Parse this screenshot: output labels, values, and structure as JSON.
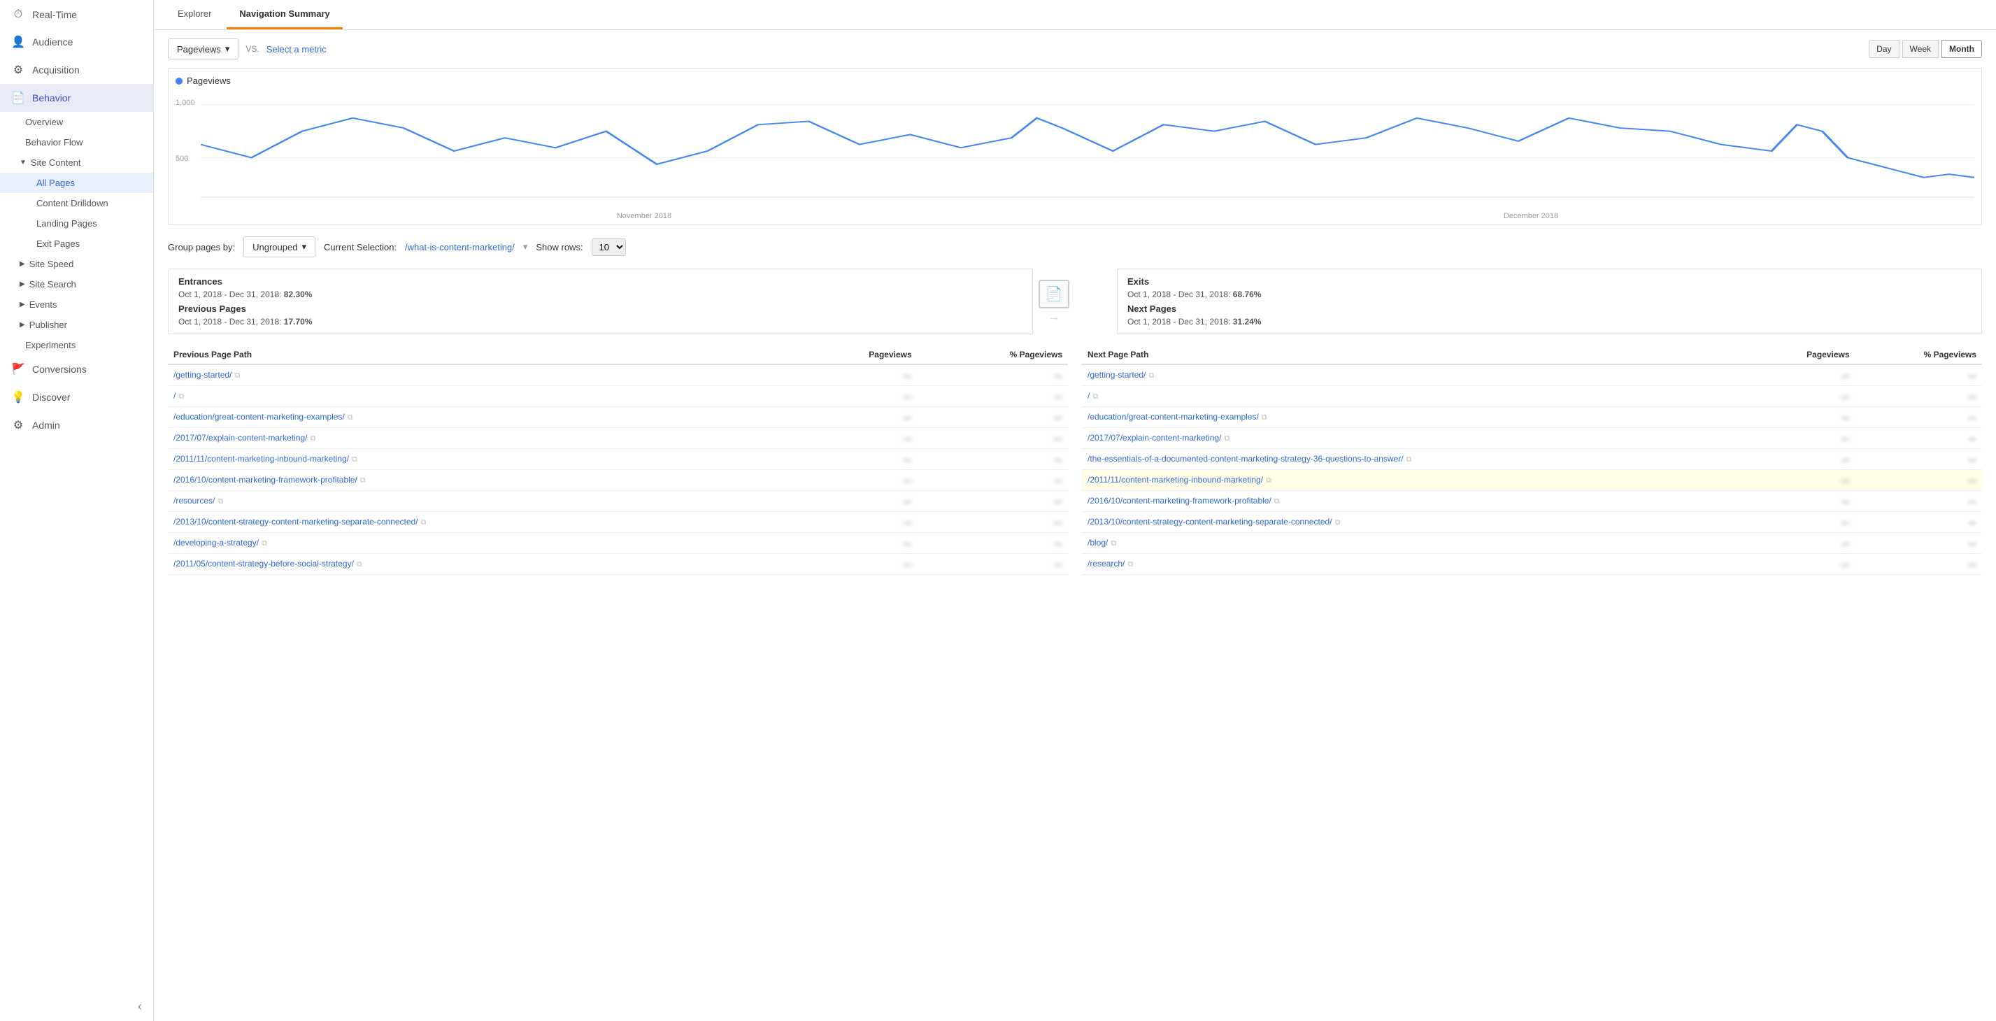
{
  "sidebar": {
    "items": [
      {
        "id": "realtime",
        "label": "Real-Time",
        "icon": "⏱"
      },
      {
        "id": "audience",
        "label": "Audience",
        "icon": "👤"
      },
      {
        "id": "acquisition",
        "label": "Acquisition",
        "icon": "⚙"
      },
      {
        "id": "behavior",
        "label": "Behavior",
        "icon": "📄",
        "active": true
      },
      {
        "id": "conversions",
        "label": "Conversions",
        "icon": "🚩"
      },
      {
        "id": "discover",
        "label": "Discover",
        "icon": "💡"
      },
      {
        "id": "admin",
        "label": "Admin",
        "icon": "⚙"
      }
    ],
    "sub_items": {
      "behavior": [
        {
          "id": "overview",
          "label": "Overview"
        },
        {
          "id": "behavior-flow",
          "label": "Behavior Flow"
        },
        {
          "id": "site-content",
          "label": "Site Content",
          "expandable": true,
          "expanded": true
        },
        {
          "id": "all-pages",
          "label": "All Pages",
          "active": true,
          "indent": true
        },
        {
          "id": "content-drilldown",
          "label": "Content Drilldown",
          "indent": true
        },
        {
          "id": "landing-pages",
          "label": "Landing Pages",
          "indent": true
        },
        {
          "id": "exit-pages",
          "label": "Exit Pages",
          "indent": true
        },
        {
          "id": "site-speed",
          "label": "Site Speed",
          "expandable": true
        },
        {
          "id": "site-search",
          "label": "Site Search",
          "expandable": true
        },
        {
          "id": "events",
          "label": "Events",
          "expandable": true
        },
        {
          "id": "publisher",
          "label": "Publisher",
          "expandable": true
        },
        {
          "id": "experiments",
          "label": "Experiments"
        }
      ]
    },
    "collapse_label": "‹"
  },
  "header": {
    "tabs": [
      {
        "id": "explorer",
        "label": "Explorer"
      },
      {
        "id": "navigation-summary",
        "label": "Navigation Summary",
        "active": true
      }
    ]
  },
  "toolbar": {
    "metric_dropdown": "Pageviews",
    "vs_label": "VS.",
    "select_metric_label": "Select a metric",
    "time_buttons": [
      {
        "id": "day",
        "label": "Day"
      },
      {
        "id": "week",
        "label": "Week"
      },
      {
        "id": "month",
        "label": "Month",
        "active": true
      }
    ]
  },
  "chart": {
    "legend_label": "Pageviews",
    "y_labels": [
      "1,000",
      "500"
    ],
    "x_labels": [
      "November 2018",
      "December 2018"
    ]
  },
  "group_by": {
    "label": "Group pages by:",
    "value": "Ungrouped",
    "current_selection_prefix": "Current Selection:",
    "current_selection_value": "/what-is-content-marketing/",
    "show_rows_prefix": "Show rows:",
    "show_rows_value": "10"
  },
  "panels": {
    "left": {
      "entrances": {
        "label": "Entrances",
        "date": "Oct 1, 2018 - Dec 31, 2018:",
        "value": "82.30%"
      },
      "previous_pages": {
        "label": "Previous Pages",
        "date": "Oct 1, 2018 - Dec 31, 2018:",
        "value": "17.70%"
      }
    },
    "right": {
      "exits": {
        "label": "Exits",
        "date": "Oct 1, 2018 - Dec 31, 2018:",
        "value": "68.76%"
      },
      "next_pages": {
        "label": "Next Pages",
        "date": "Oct 1, 2018 - Dec 31, 2018:",
        "value": "31.24%"
      }
    }
  },
  "previous_table": {
    "columns": [
      "Previous Page Path",
      "Pageviews",
      "% Pageviews"
    ],
    "rows": [
      {
        "path": "/getting-started/",
        "pageviews": "—",
        "pct": "—"
      },
      {
        "path": "/",
        "pageviews": "—",
        "pct": "—"
      },
      {
        "path": "/education/great-content-marketing-examples/",
        "pageviews": "—",
        "pct": "—"
      },
      {
        "path": "/2017/07/explain-content-marketing/",
        "pageviews": "—",
        "pct": "—"
      },
      {
        "path": "/2011/11/content-marketing-inbound-marketing/",
        "pageviews": "—",
        "pct": "—"
      },
      {
        "path": "/2016/10/content-marketing-framework-profitable/",
        "pageviews": "—",
        "pct": "—"
      },
      {
        "path": "/resources/",
        "pageviews": "—",
        "pct": "—"
      },
      {
        "path": "/2013/10/content-strategy-content-marketing-separate-connected/",
        "pageviews": "—",
        "pct": "—"
      },
      {
        "path": "/developing-a-strategy/",
        "pageviews": "—",
        "pct": "—"
      },
      {
        "path": "/2011/05/content-strategy-before-social-strategy/",
        "pageviews": "—",
        "pct": "—"
      }
    ]
  },
  "next_table": {
    "columns": [
      "Next Page Path",
      "Pageviews",
      "% Pageviews"
    ],
    "rows": [
      {
        "path": "/getting-started/",
        "pageviews": "—",
        "pct": "—",
        "highlight": false
      },
      {
        "path": "/",
        "pageviews": "—",
        "pct": "—",
        "highlight": false
      },
      {
        "path": "/education/great-content-marketing-examples/",
        "pageviews": "—",
        "pct": "—",
        "highlight": false
      },
      {
        "path": "/2017/07/explain-content-marketing/",
        "pageviews": "—",
        "pct": "—",
        "highlight": false
      },
      {
        "path": "/the-essentials-of-a-documented-content-marketing-strategy-36-questions-to-answer/",
        "pageviews": "—",
        "pct": "—",
        "highlight": false
      },
      {
        "path": "/2011/11/content-marketing-inbound-marketing/",
        "pageviews": "—",
        "pct": "—",
        "highlight": true
      },
      {
        "path": "/2016/10/content-marketing-framework-profitable/",
        "pageviews": "—",
        "pct": "—",
        "highlight": false
      },
      {
        "path": "/2013/10/content-strategy-content-marketing-separate-connected/",
        "pageviews": "—",
        "pct": "—",
        "highlight": false
      },
      {
        "path": "/blog/",
        "pageviews": "—",
        "pct": "—",
        "highlight": false
      },
      {
        "path": "/research/",
        "pageviews": "—",
        "pct": "—",
        "highlight": false
      }
    ]
  },
  "colors": {
    "accent_blue": "#3367d6",
    "chart_blue": "#4285f4",
    "active_nav": "#e8f0fe",
    "highlight_yellow": "#fffde7",
    "tab_active_orange": "#f57c00"
  }
}
